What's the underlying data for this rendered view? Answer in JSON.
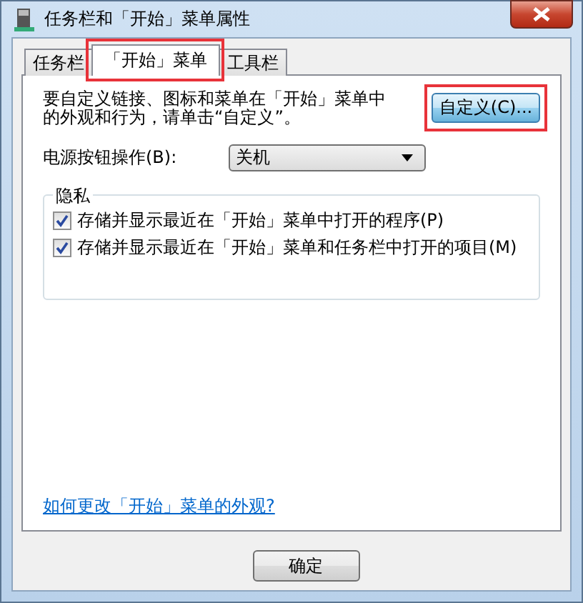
{
  "window": {
    "title": "任务栏和「开始」菜单属性"
  },
  "tabs": [
    {
      "label": "任务栏",
      "selected": false,
      "highlighted": false
    },
    {
      "label": "「开始」菜单",
      "selected": true,
      "highlighted": true
    },
    {
      "label": "工具栏",
      "selected": false,
      "highlighted": false
    }
  ],
  "intro": {
    "text": "要自定义链接、图标和菜单在「开始」菜单中的外观和行为，请单击“自定义”。",
    "button": "自定义(C)...",
    "highlighted": true
  },
  "power": {
    "label": "电源按钮操作(B):",
    "value": "关机"
  },
  "privacy": {
    "title": "隐私",
    "options": [
      {
        "label": "存储并显示最近在「开始」菜单中打开的程序(P)",
        "checked": true
      },
      {
        "label": "存储并显示最近在「开始」菜单和任务栏中打开的项目(M)",
        "checked": true
      }
    ]
  },
  "help_link": "如何更改「开始」菜单的外观?",
  "buttons": [
    "确定"
  ]
}
